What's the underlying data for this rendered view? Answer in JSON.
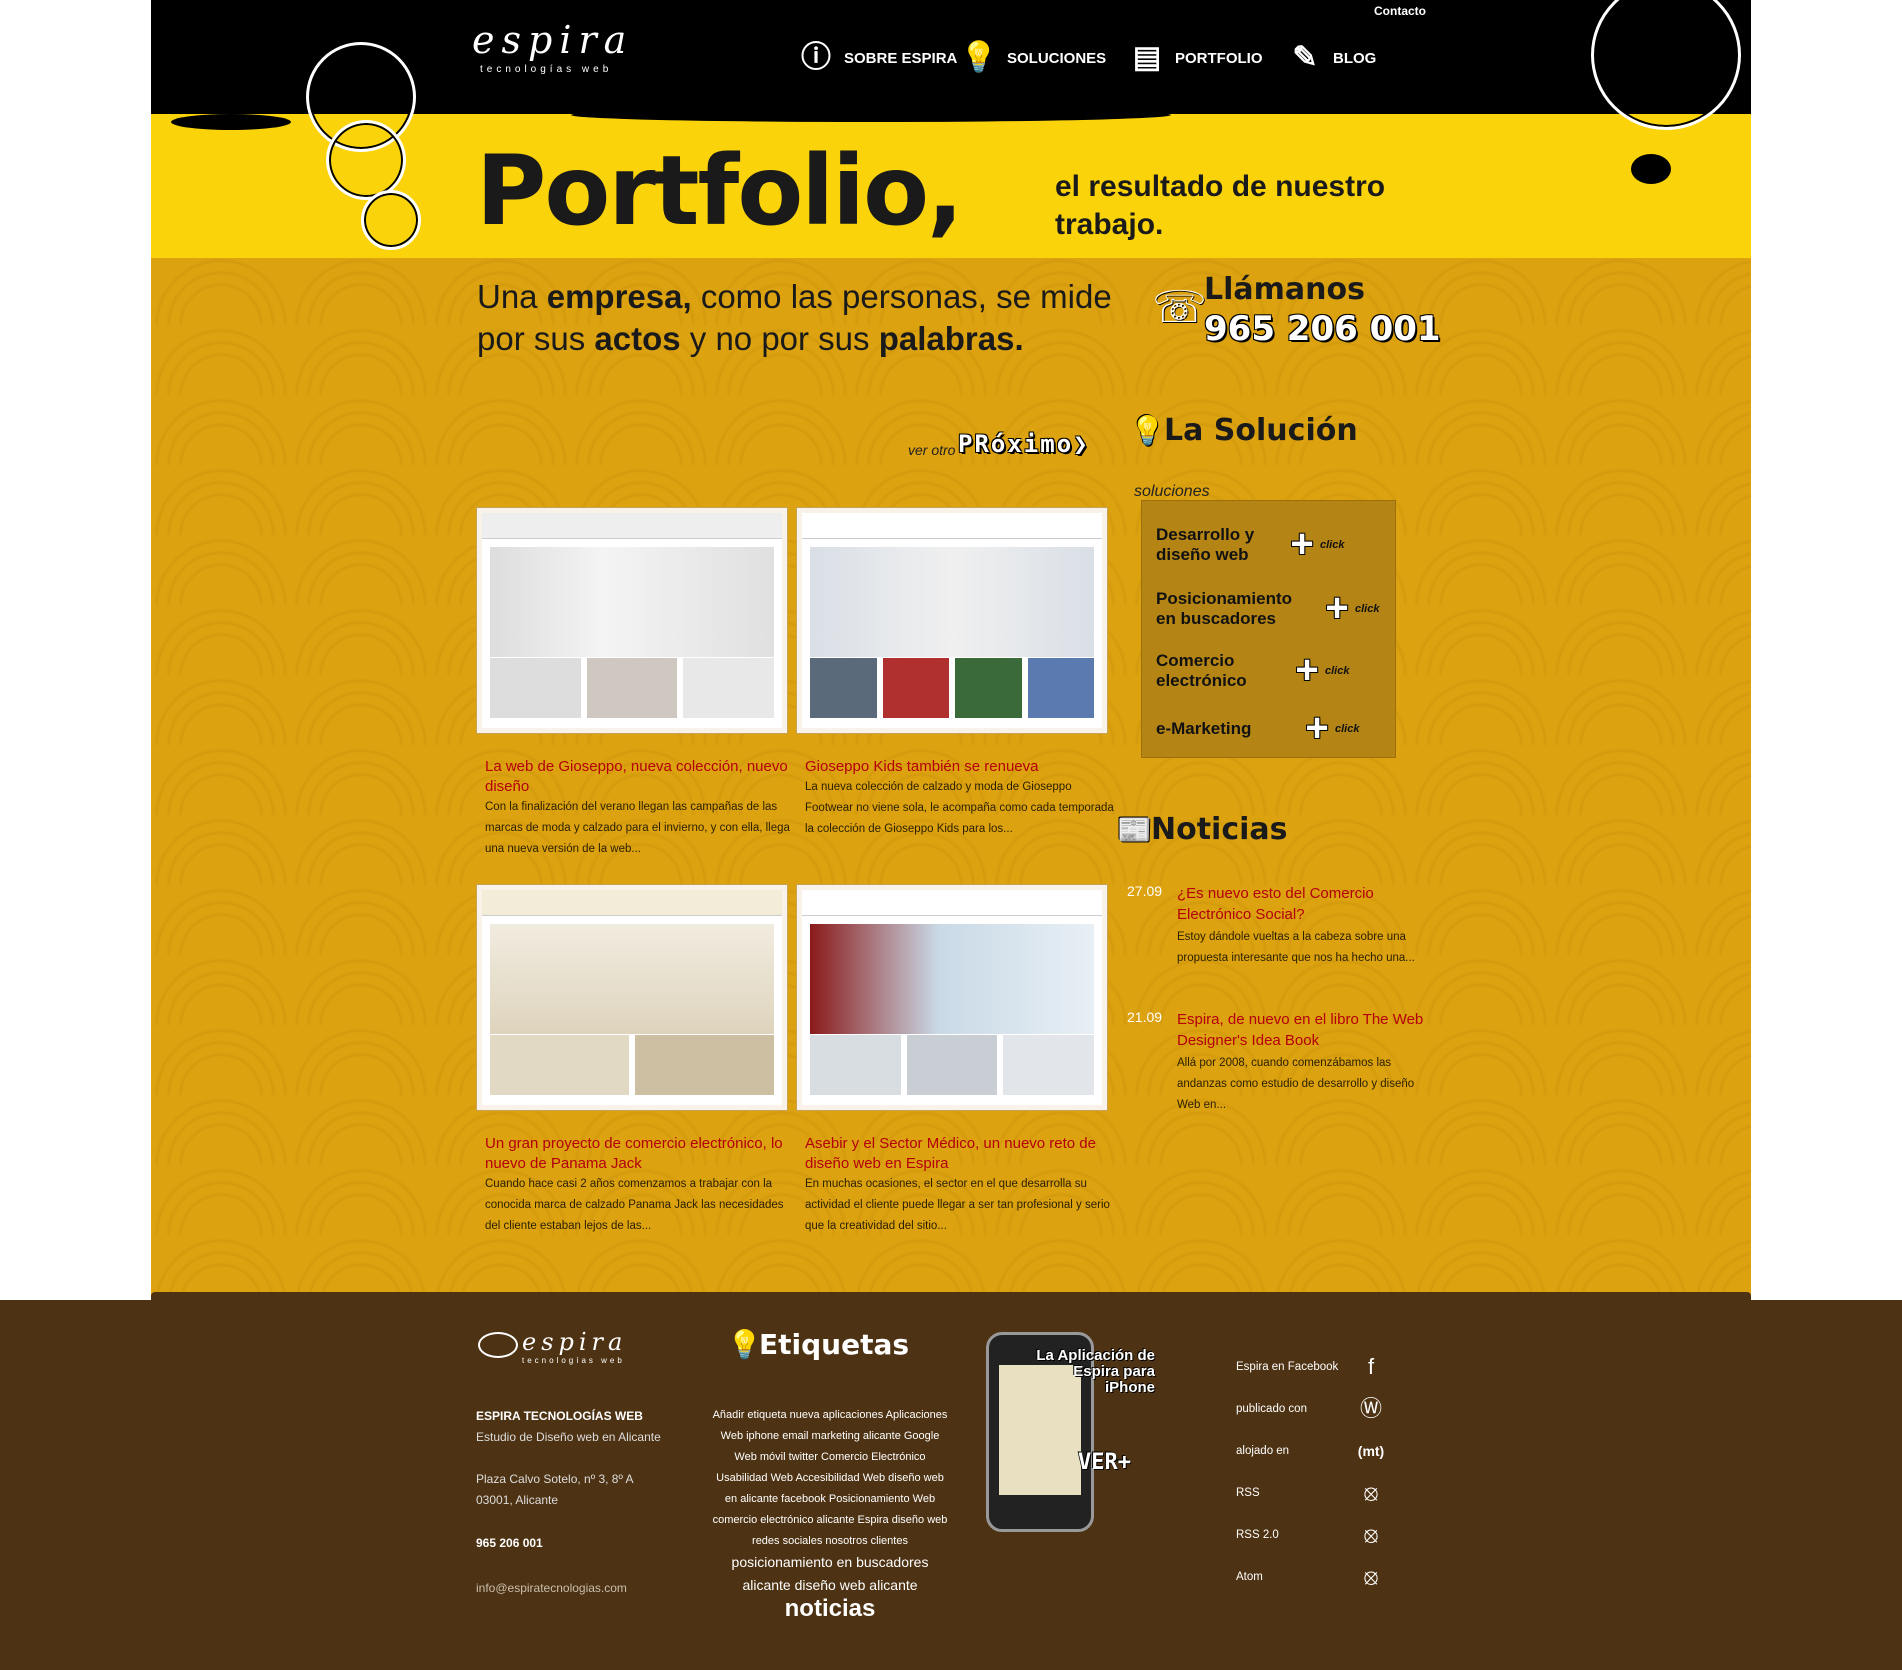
{
  "header": {
    "logo_word": "espira",
    "logo_sub": "tecnologías web",
    "contact": "Contacto",
    "nav": [
      {
        "label": "SOBRE ESPIRA",
        "icon": "info-icon"
      },
      {
        "label": "SOLUCIONES",
        "icon": "lightbulb-icon"
      },
      {
        "label": "PORTFOLIO",
        "icon": "briefcase-icon"
      },
      {
        "label": "BLOG",
        "icon": "speech-icon"
      }
    ]
  },
  "hero": {
    "title": "Portfolio,",
    "subtitle": "el resultado de nuestro trabajo.",
    "tagline_parts": [
      "Una ",
      "empresa,",
      " como las personas, se mide por sus ",
      "actos",
      " y no por sus ",
      "palabras."
    ]
  },
  "next_link": {
    "small": "ver otro",
    "label": "PRóximo"
  },
  "projects": [
    {
      "title": "La web de Gioseppo, nueva colección, nuevo diseño",
      "excerpt": "Con la finalización del verano llegan las campañas de las marcas de moda y calzado para el invierno, y con ella, llega una nueva versión de la web..."
    },
    {
      "title": "Gioseppo Kids también se renueva",
      "excerpt": "La nueva colección de calzado y moda de Gioseppo Footwear no viene sola, le acompaña como cada temporada la colección de Gioseppo Kids para los..."
    },
    {
      "title": "Un gran proyecto de comercio electrónico, lo nuevo de Panama Jack",
      "excerpt": "Cuando hace casi 2 años comenzamos a trabajar con la conocida marca de calzado Panama Jack las necesidades del cliente estaban lejos de las..."
    },
    {
      "title": "Asebir y el Sector Médico, un nuevo reto de diseño web en Espira",
      "excerpt": "En muchas ocasiones, el sector en el que desarrolla su actividad el cliente puede llegar a ser tan profesional y serio que la creatividad del sitio..."
    }
  ],
  "sidebar": {
    "call_title": "Llámanos",
    "call_number": "965 206 001",
    "solution_title": "La Solución",
    "solutions_label": "soluciones",
    "solutions": [
      {
        "label": "Desarrollo y diseño web"
      },
      {
        "label": "Posicionamiento en buscadores"
      },
      {
        "label": "Comercio electrónico"
      },
      {
        "label": "e-Marketing"
      }
    ],
    "click_label": "click",
    "news_title": "Noticias",
    "news": [
      {
        "date": "27.09",
        "title": "¿Es nuevo esto del Comercio Electrónico Social?",
        "excerpt": "Estoy dándole vueltas a la cabeza sobre una propuesta interesante que nos ha hecho una..."
      },
      {
        "date": "21.09",
        "title": "Espira, de nuevo en el libro The Web Designer's Idea Book",
        "excerpt": "Allá por 2008, cuando comenzábamos las andanzas como estudio de desarrollo y diseño Web en..."
      }
    ]
  },
  "footer": {
    "logo_word": "espira",
    "logo_sub": "tecnologías web",
    "company": "ESPIRA TECNOLOGÍAS WEB",
    "desc": "Estudio de Diseño web en Alicante",
    "address1": "Plaza Calvo Sotelo, nº 3, 8º A",
    "address2": "03001, Alicante",
    "phone": "965 206 001",
    "email": "info@espiratecnologias.com",
    "tags_title": "Etiquetas",
    "tags_text": "Añadir etiqueta nueva aplicaciones Aplicaciones Web iphone email marketing alicante Google Web móvil twitter Comercio Electrónico Usabilidad Web Accesibilidad Web diseño web en alicante facebook Posicionamiento Web comercio electrónico alicante Espira diseño web redes sociales nosotros clientes",
    "tags_md": "posicionamiento en buscadores alicante diseño web alicante",
    "tags_big": "noticias",
    "app_title": "La Aplicación de Espira para iPhone",
    "app_cta": "VER+",
    "social": [
      {
        "label": "Espira en Facebook",
        "icon": "facebook-icon"
      },
      {
        "label": "publicado con",
        "icon": "wordpress-icon"
      },
      {
        "label": "alojado en",
        "icon": "mt-icon"
      },
      {
        "label": "RSS",
        "icon": "rss-icon"
      },
      {
        "label": "RSS 2.0",
        "icon": "rss-icon"
      },
      {
        "label": "Atom",
        "icon": "rss-icon"
      }
    ]
  },
  "colors": {
    "yellow": "#fbd30b",
    "mustard": "#dca20f",
    "brown": "#4d3213",
    "red": "#b4000d"
  }
}
